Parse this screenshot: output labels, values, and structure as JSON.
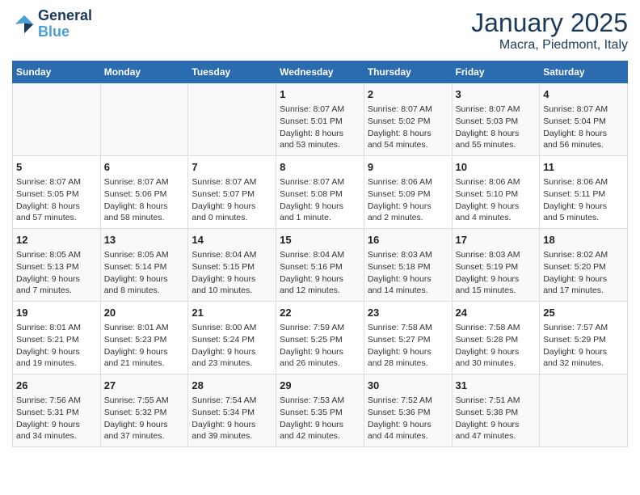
{
  "header": {
    "logo_line1": "General",
    "logo_line2": "Blue",
    "month": "January 2025",
    "location": "Macra, Piedmont, Italy"
  },
  "days_of_week": [
    "Sunday",
    "Monday",
    "Tuesday",
    "Wednesday",
    "Thursday",
    "Friday",
    "Saturday"
  ],
  "weeks": [
    [
      {
        "day": "",
        "content": ""
      },
      {
        "day": "",
        "content": ""
      },
      {
        "day": "",
        "content": ""
      },
      {
        "day": "1",
        "content": "Sunrise: 8:07 AM\nSunset: 5:01 PM\nDaylight: 8 hours\nand 53 minutes."
      },
      {
        "day": "2",
        "content": "Sunrise: 8:07 AM\nSunset: 5:02 PM\nDaylight: 8 hours\nand 54 minutes."
      },
      {
        "day": "3",
        "content": "Sunrise: 8:07 AM\nSunset: 5:03 PM\nDaylight: 8 hours\nand 55 minutes."
      },
      {
        "day": "4",
        "content": "Sunrise: 8:07 AM\nSunset: 5:04 PM\nDaylight: 8 hours\nand 56 minutes."
      }
    ],
    [
      {
        "day": "5",
        "content": "Sunrise: 8:07 AM\nSunset: 5:05 PM\nDaylight: 8 hours\nand 57 minutes."
      },
      {
        "day": "6",
        "content": "Sunrise: 8:07 AM\nSunset: 5:06 PM\nDaylight: 8 hours\nand 58 minutes."
      },
      {
        "day": "7",
        "content": "Sunrise: 8:07 AM\nSunset: 5:07 PM\nDaylight: 9 hours\nand 0 minutes."
      },
      {
        "day": "8",
        "content": "Sunrise: 8:07 AM\nSunset: 5:08 PM\nDaylight: 9 hours\nand 1 minute."
      },
      {
        "day": "9",
        "content": "Sunrise: 8:06 AM\nSunset: 5:09 PM\nDaylight: 9 hours\nand 2 minutes."
      },
      {
        "day": "10",
        "content": "Sunrise: 8:06 AM\nSunset: 5:10 PM\nDaylight: 9 hours\nand 4 minutes."
      },
      {
        "day": "11",
        "content": "Sunrise: 8:06 AM\nSunset: 5:11 PM\nDaylight: 9 hours\nand 5 minutes."
      }
    ],
    [
      {
        "day": "12",
        "content": "Sunrise: 8:05 AM\nSunset: 5:13 PM\nDaylight: 9 hours\nand 7 minutes."
      },
      {
        "day": "13",
        "content": "Sunrise: 8:05 AM\nSunset: 5:14 PM\nDaylight: 9 hours\nand 8 minutes."
      },
      {
        "day": "14",
        "content": "Sunrise: 8:04 AM\nSunset: 5:15 PM\nDaylight: 9 hours\nand 10 minutes."
      },
      {
        "day": "15",
        "content": "Sunrise: 8:04 AM\nSunset: 5:16 PM\nDaylight: 9 hours\nand 12 minutes."
      },
      {
        "day": "16",
        "content": "Sunrise: 8:03 AM\nSunset: 5:18 PM\nDaylight: 9 hours\nand 14 minutes."
      },
      {
        "day": "17",
        "content": "Sunrise: 8:03 AM\nSunset: 5:19 PM\nDaylight: 9 hours\nand 15 minutes."
      },
      {
        "day": "18",
        "content": "Sunrise: 8:02 AM\nSunset: 5:20 PM\nDaylight: 9 hours\nand 17 minutes."
      }
    ],
    [
      {
        "day": "19",
        "content": "Sunrise: 8:01 AM\nSunset: 5:21 PM\nDaylight: 9 hours\nand 19 minutes."
      },
      {
        "day": "20",
        "content": "Sunrise: 8:01 AM\nSunset: 5:23 PM\nDaylight: 9 hours\nand 21 minutes."
      },
      {
        "day": "21",
        "content": "Sunrise: 8:00 AM\nSunset: 5:24 PM\nDaylight: 9 hours\nand 23 minutes."
      },
      {
        "day": "22",
        "content": "Sunrise: 7:59 AM\nSunset: 5:25 PM\nDaylight: 9 hours\nand 26 minutes."
      },
      {
        "day": "23",
        "content": "Sunrise: 7:58 AM\nSunset: 5:27 PM\nDaylight: 9 hours\nand 28 minutes."
      },
      {
        "day": "24",
        "content": "Sunrise: 7:58 AM\nSunset: 5:28 PM\nDaylight: 9 hours\nand 30 minutes."
      },
      {
        "day": "25",
        "content": "Sunrise: 7:57 AM\nSunset: 5:29 PM\nDaylight: 9 hours\nand 32 minutes."
      }
    ],
    [
      {
        "day": "26",
        "content": "Sunrise: 7:56 AM\nSunset: 5:31 PM\nDaylight: 9 hours\nand 34 minutes."
      },
      {
        "day": "27",
        "content": "Sunrise: 7:55 AM\nSunset: 5:32 PM\nDaylight: 9 hours\nand 37 minutes."
      },
      {
        "day": "28",
        "content": "Sunrise: 7:54 AM\nSunset: 5:34 PM\nDaylight: 9 hours\nand 39 minutes."
      },
      {
        "day": "29",
        "content": "Sunrise: 7:53 AM\nSunset: 5:35 PM\nDaylight: 9 hours\nand 42 minutes."
      },
      {
        "day": "30",
        "content": "Sunrise: 7:52 AM\nSunset: 5:36 PM\nDaylight: 9 hours\nand 44 minutes."
      },
      {
        "day": "31",
        "content": "Sunrise: 7:51 AM\nSunset: 5:38 PM\nDaylight: 9 hours\nand 47 minutes."
      },
      {
        "day": "",
        "content": ""
      }
    ]
  ]
}
